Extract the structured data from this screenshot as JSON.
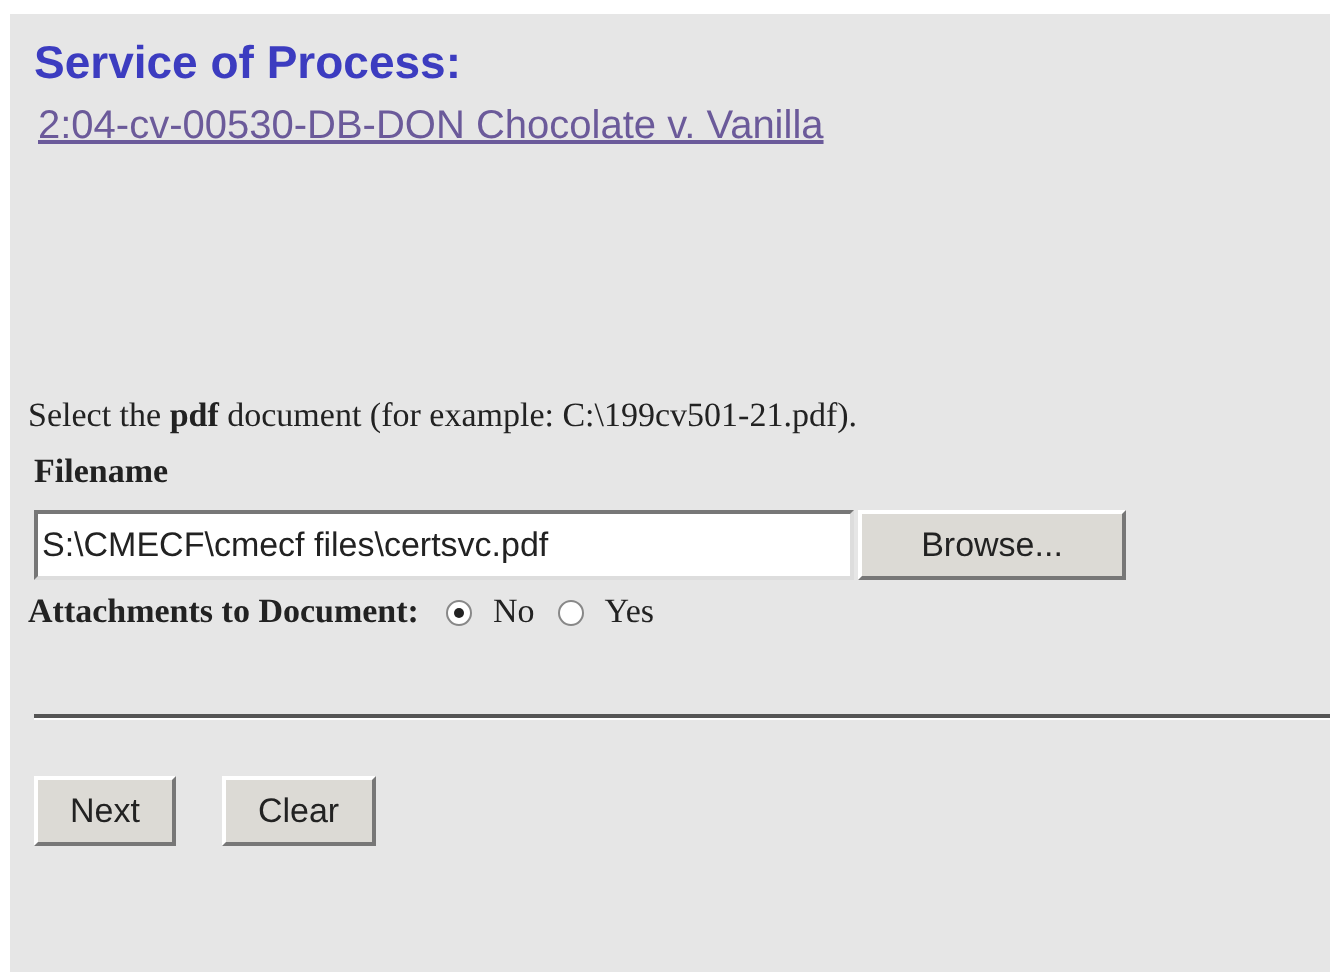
{
  "heading": "Service of Process:",
  "case_link": "2:04-cv-00530-DB-DON Chocolate v. Vanilla",
  "instruction": "Select the **pdf** document (for example: C:\\199cv501-21.pdf).",
  "filename": {
    "label": "Filename",
    "value": "S:\\CMECF\\cmecf files\\certsvc.pdf",
    "browse_button": "Browse..."
  },
  "attachments": {
    "label": "Attachments to Document:",
    "options": [
      {
        "label": "No",
        "selected": true
      },
      {
        "label": "Yes",
        "selected": false
      }
    ]
  },
  "buttons": [
    "Next",
    "Clear"
  ]
}
